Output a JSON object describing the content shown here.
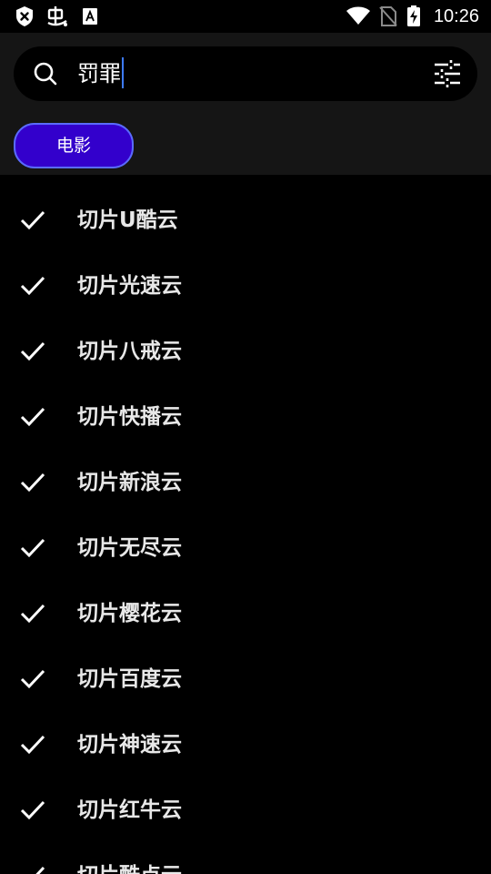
{
  "status_bar": {
    "time": "10:26",
    "icons": [
      "shield-x-icon",
      "bug-icon",
      "font-a-icon",
      "wifi-icon",
      "no-sim-icon",
      "battery-charging-icon"
    ]
  },
  "search": {
    "query": "罚罪",
    "icon": "search-icon",
    "filter_icon": "sliders-icon"
  },
  "chip": {
    "label": "电影",
    "color": "#3300cc"
  },
  "sources": [
    {
      "label": "切片U酷云",
      "checked": true
    },
    {
      "label": "切片光速云",
      "checked": true
    },
    {
      "label": "切片八戒云",
      "checked": true
    },
    {
      "label": "切片快播云",
      "checked": true
    },
    {
      "label": "切片新浪云",
      "checked": true
    },
    {
      "label": "切片无尽云",
      "checked": true
    },
    {
      "label": "切片樱花云",
      "checked": true
    },
    {
      "label": "切片百度云",
      "checked": true
    },
    {
      "label": "切片神速云",
      "checked": true
    },
    {
      "label": "切片红牛云",
      "checked": true
    },
    {
      "label": "切片酷点云",
      "checked": true
    }
  ],
  "colors": {
    "background": "#000000",
    "header": "#151515",
    "accent": "#3300cc",
    "caret": "#3d7bff"
  }
}
